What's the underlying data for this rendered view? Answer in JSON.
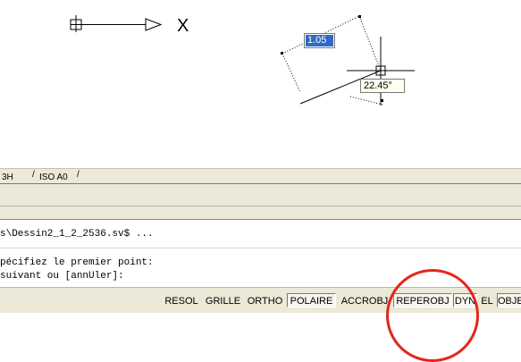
{
  "drawing": {
    "dimension_value": "1.05",
    "angle_value": "22.45°",
    "ucs_axis_label": "X"
  },
  "layout_tabs": [
    {
      "label": "3H"
    },
    {
      "label": "ISO A0"
    }
  ],
  "command_window": {
    "lines": [
      "s\\Dessin2_1_2_2536.sv$ ...",
      "pécifiez le premier point:",
      "suivant ou [annUler]:"
    ]
  },
  "status_bar": {
    "buttons": [
      {
        "label": "RESOL",
        "state": "off"
      },
      {
        "label": "GRILLE",
        "state": "off"
      },
      {
        "label": "ORTHO",
        "state": "off"
      },
      {
        "label": "POLAIRE",
        "state": "on"
      },
      {
        "label": "ACCROBJ",
        "state": "off"
      },
      {
        "label": "REPEROBJ",
        "state": "on"
      },
      {
        "label": "DYN",
        "state": "on"
      },
      {
        "label": "EL",
        "state": "off"
      },
      {
        "label": "OBJET",
        "state": "on"
      }
    ]
  },
  "colors": {
    "highlight_circle": "#e3261c",
    "dyn_input_bg": "#2f6ac4",
    "panel_bg": "#ece9d8"
  }
}
